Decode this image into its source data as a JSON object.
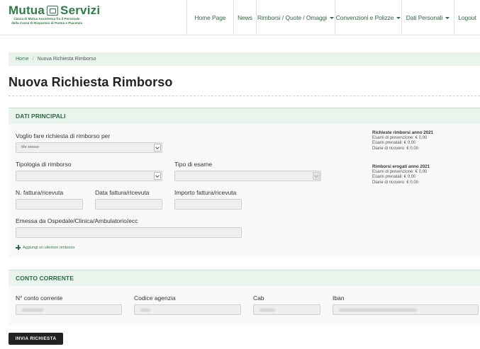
{
  "logo": {
    "title_left": "Mutua",
    "title_right": "Servizi",
    "subtitle_line1": "Cassa di Mutua Assistenza fra il Personale",
    "subtitle_line2": "della Cassa di Risparmio di Parma e Piacenza"
  },
  "nav": {
    "items": [
      {
        "label": "Home Page"
      },
      {
        "label": "News"
      },
      {
        "label": "Rimborsi / Quote / Omaggi"
      },
      {
        "label": "Convenzioni e Polizze"
      },
      {
        "label": "Dati Personali"
      },
      {
        "label": "Logout"
      }
    ]
  },
  "breadcrumb": {
    "home": "Home",
    "separator": "/",
    "current": "Nuova Richiesta Rimborso"
  },
  "page": {
    "title": "Nuova Richiesta Rimborso"
  },
  "dati_principali": {
    "header": "DATI PRINCIPALI",
    "richiesta_per_label": "Voglio fare richiesta di rimborso per",
    "richiesta_per_value": "Me stesso",
    "tipologia_label": "Tipologia di rimborso",
    "tipologia_value": "",
    "tipo_esame_label": "Tipo di esame",
    "tipo_esame_value": "",
    "n_fattura_label": "N. fattura/ricevuta",
    "data_fattura_label": "Data fattura/ricevuta",
    "importo_label": "Importo fattura/ricevuta",
    "emessa_label": "Emessa da Ospedale/Clinica/Ambulatorio/ecc",
    "add_link": "Aggiungi un ulteriore rimborso"
  },
  "stats": {
    "richieste": {
      "title": "Richieste rimborsi anno 2021",
      "lines": [
        "Esami di prevenzione: € 0.00",
        "Esami prenatali: € 0.00",
        "Diarie di ricovero: € 0.00"
      ]
    },
    "erogati": {
      "title": "Rimborsi erogati anno 2021",
      "lines": [
        "Esami di prevenzione: € 0.00",
        "Esami prenatali: € 0.00",
        "Diarie di ricovero: € 0.00"
      ]
    }
  },
  "conto_corrente": {
    "header": "CONTO CORRENTE",
    "conto_label": "N° conto corrente",
    "agenzia_label": "Codice agenzia",
    "cab_label": "Cab",
    "iban_label": "Iban"
  },
  "submit": {
    "label": "INVIA RICHIESTA"
  },
  "colors": {
    "brand_green": "#2d7d48",
    "panel_bg": "#e8f4ec",
    "button_dark": "#222222"
  }
}
